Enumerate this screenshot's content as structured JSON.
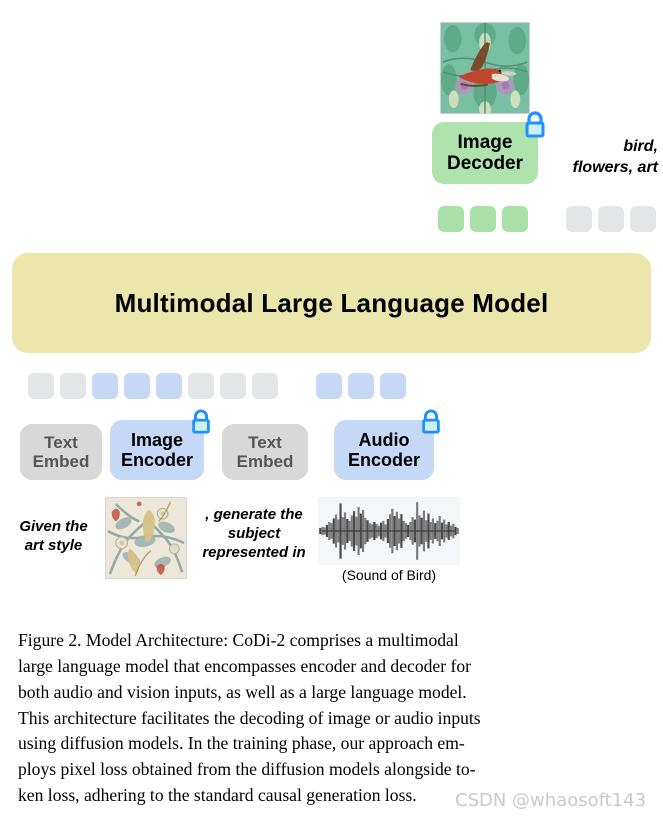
{
  "figure": {
    "output_image_alt": "bird-tapestry-image",
    "output_caption": "bird,\nflowers, art",
    "mllm_label": "Multimodal Large Language Model",
    "decoder": {
      "line1": "Image",
      "line2": "Decoder",
      "lock": "lock-icon"
    },
    "encoders": [
      {
        "id": "text-embed-1",
        "line1": "Text",
        "line2": "Embed",
        "style": "grayb",
        "lock": false
      },
      {
        "id": "image-encoder",
        "line1": "Image",
        "line2": "Encoder",
        "style": "blue",
        "lock": true
      },
      {
        "id": "text-embed-2",
        "line1": "Text",
        "line2": "Embed",
        "style": "grayb",
        "lock": false
      },
      {
        "id": "audio-encoder",
        "line1": "Audio",
        "line2": "Encoder",
        "style": "blue",
        "lock": true
      }
    ],
    "prompt": {
      "part1": "Given the\nart style",
      "part2": ", generate the\nsubject\nrepresented in",
      "audio_caption": "(Sound of Bird)",
      "art_image_alt": "art-style-swatch",
      "waveform_alt": "audio-waveform"
    },
    "tokens_output": [
      "green",
      "green",
      "green",
      "gap",
      "gray",
      "gray",
      "gray"
    ],
    "tokens_input": [
      "gray",
      "gray",
      "blue",
      "blue",
      "blue",
      "gray",
      "gray",
      "gray",
      "gap",
      "blue",
      "blue",
      "blue"
    ],
    "colors": {
      "token_gray": "#e4e5e6",
      "token_blue": "#c5d9f7",
      "token_green": "#a9e0a9",
      "mllm_bg": "#ebe6ab",
      "decoder_bg": "#aee3ae",
      "encoder_blue_bg": "#c5d9f7",
      "encoder_gray_bg": "#d8d8d8",
      "lock_stroke": "#1e90ff",
      "lock_fill": "#cdf0f7",
      "watermark": "#c9c9c9"
    }
  },
  "caption": {
    "lines": [
      "Figure 2.  Model Architecture:  CoDi-2 comprises a multimodal",
      "large language model that encompasses encoder and decoder for",
      "both audio and vision inputs, as well as a large language model.",
      "This architecture facilitates the decoding of image or audio inputs",
      "using diffusion models.  In the training phase, our approach em-",
      "ploys pixel loss obtained from the diffusion models alongside to-",
      "ken loss, adhering to the standard causal generation loss."
    ]
  },
  "watermark": {
    "text": "CSDN @whaosoft143"
  }
}
